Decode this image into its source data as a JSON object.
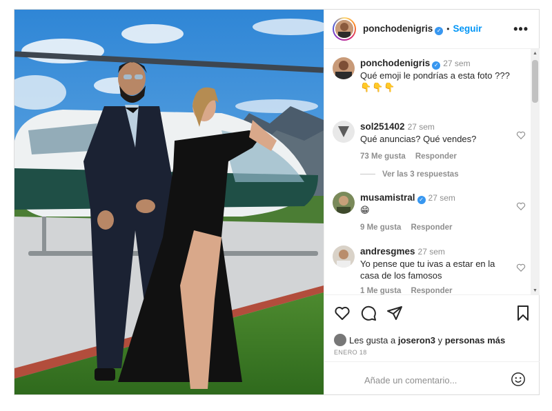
{
  "post": {
    "author": {
      "username": "ponchodenigris",
      "verified": true,
      "follow_label": "Seguir",
      "more_label": "•••"
    },
    "caption": {
      "username": "ponchodenigris",
      "time": "27 sem",
      "text": "Qué emoji le pondrías a esta foto ???",
      "emoji": "👇👇👇"
    },
    "comments": [
      {
        "username": "sol251402",
        "time": "27 sem",
        "text": "Qué anuncias? Qué vendes?",
        "likes": "73 Me gusta",
        "reply_label": "Responder",
        "verified": false
      },
      {
        "username": "musamistral",
        "time": "27 sem",
        "text": "😁",
        "likes": "9 Me gusta",
        "reply_label": "Responder",
        "verified": true
      },
      {
        "username": "andresgmes",
        "time": "27 sem",
        "text": "Yo pense que tu ivas a estar en la casa de los famosos",
        "likes": "1 Me gusta",
        "reply_label": "Responder",
        "verified": false
      }
    ],
    "view_replies": "Ver las 3 respuestas",
    "liked_by": {
      "prefix": "Les gusta a",
      "user": "joseron3",
      "connector": "y",
      "others": "personas más"
    },
    "date": "ENERO 18",
    "add_comment_placeholder": "Añade un comentario...",
    "icons": [
      "heart-icon",
      "comment-icon",
      "share-icon",
      "bookmark-icon",
      "emoji-icon",
      "more-icon",
      "verified-icon"
    ],
    "colors": {
      "accent": "#0095f6",
      "verified": "#3897f0",
      "muted": "#8e8e8e"
    }
  }
}
